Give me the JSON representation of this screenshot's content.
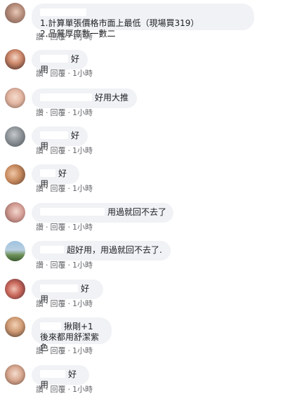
{
  "actions": {
    "like": "讚",
    "reply": "回覆",
    "sep": "·",
    "time": "1小時"
  },
  "comments": [
    {
      "lines": [
        "1.計算單張價格市面上最低（現場買319）",
        "2.品質厚度數一數二"
      ]
    },
    {
      "lines": [
        "好用"
      ]
    },
    {
      "lines": [
        "好用大推"
      ]
    },
    {
      "lines": [
        "好用"
      ]
    },
    {
      "lines": [
        "好用"
      ]
    },
    {
      "lines": [
        "用過就回不去了"
      ]
    },
    {
      "lines": [
        "超好用，用過就回不去了."
      ]
    },
    {
      "lines": [
        "好用"
      ]
    },
    {
      "lines": [
        "揪剛+1",
        "後來都用舒潔紫色"
      ]
    },
    {
      "lines": [
        "好用"
      ]
    }
  ]
}
